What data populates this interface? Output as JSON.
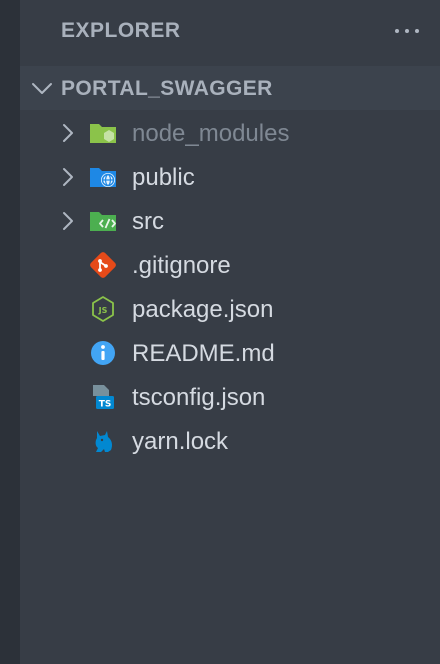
{
  "explorer": {
    "title": "EXPLORER",
    "more_icon": "ellipsis-icon"
  },
  "project": {
    "name": "PORTAL_SWAGGER",
    "expanded": true
  },
  "items": [
    {
      "label": "node_modules",
      "kind": "folder",
      "icon": "node-folder-icon",
      "color": "#8bc34a",
      "dimmed": true
    },
    {
      "label": "public",
      "kind": "folder",
      "icon": "public-folder-icon",
      "color": "#1e88e5",
      "dimmed": false
    },
    {
      "label": "src",
      "kind": "folder",
      "icon": "src-folder-icon",
      "color": "#4caf50",
      "dimmed": false
    },
    {
      "label": ".gitignore",
      "kind": "file",
      "icon": "git-icon",
      "color": "#e64a19",
      "dimmed": false
    },
    {
      "label": "package.json",
      "kind": "file",
      "icon": "nodejs-icon",
      "color": "#8bc34a",
      "dimmed": false
    },
    {
      "label": "README.md",
      "kind": "file",
      "icon": "info-icon",
      "color": "#42a5f5",
      "dimmed": false
    },
    {
      "label": "tsconfig.json",
      "kind": "file",
      "icon": "tsconfig-icon",
      "color": "#0288d1",
      "dimmed": false
    },
    {
      "label": "yarn.lock",
      "kind": "file",
      "icon": "yarn-icon",
      "color": "#0288d1",
      "dimmed": false
    }
  ]
}
